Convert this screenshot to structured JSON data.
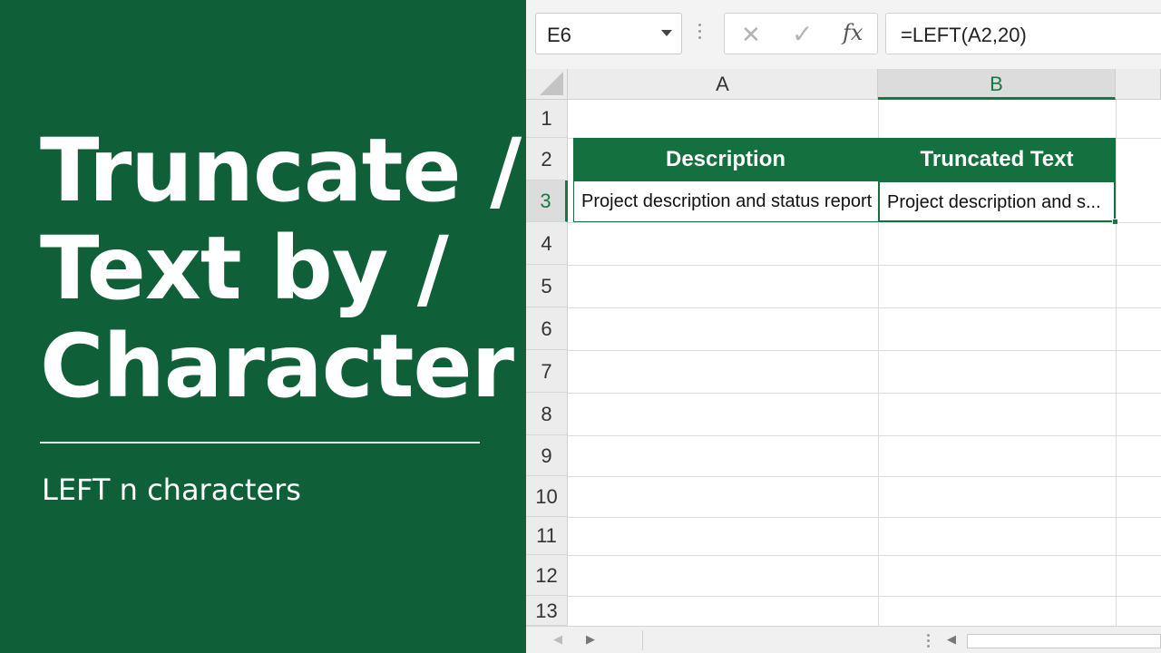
{
  "banner": {
    "title_lines": [
      "Truncate /",
      "Text by /",
      "Character"
    ],
    "subtitle": "LEFT n characters",
    "background": "#0f5f38"
  },
  "formula_bar": {
    "name_box": "E6",
    "formula": "=LEFT(A2,20)",
    "fx_label": "fx"
  },
  "columns": [
    "A",
    "B"
  ],
  "rows": [
    "1",
    "2",
    "3",
    "4",
    "5",
    "6",
    "7",
    "8",
    "9",
    "10",
    "11",
    "12",
    "13"
  ],
  "table": {
    "headers": [
      "Description",
      "Truncated Text"
    ],
    "row": [
      "Project description and status report",
      "Project description and s..."
    ],
    "header_color": "#15703f"
  },
  "icons": {
    "cancel": "x-icon",
    "enter": "checkmark-icon",
    "function": "fx-icon"
  }
}
